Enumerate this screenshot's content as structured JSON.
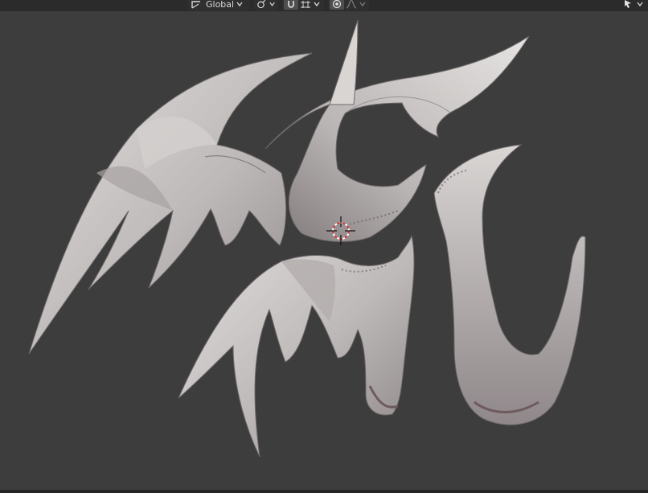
{
  "header": {
    "transform_orientation": {
      "label": "Global",
      "icon": "transform-orientation-icon"
    },
    "pivot_point": {
      "icon": "pivot-point-icon"
    },
    "snapping": {
      "icon": "magnet-icon",
      "mode_icon": "snap-increment-icon"
    },
    "proportional_editing": {
      "icon": "proportional-editing-icon",
      "falloff_icon": "falloff-curve-icon"
    },
    "select_tool": {
      "icon": "cursor-select-icon"
    }
  },
  "viewport": {
    "background_color": "#3d3d3d",
    "object": "sculpted-horn-mesh",
    "mesh_color": "#c9c6c4",
    "shadow_color": "#5a4f52",
    "cursor_color": "#d93a3a"
  }
}
